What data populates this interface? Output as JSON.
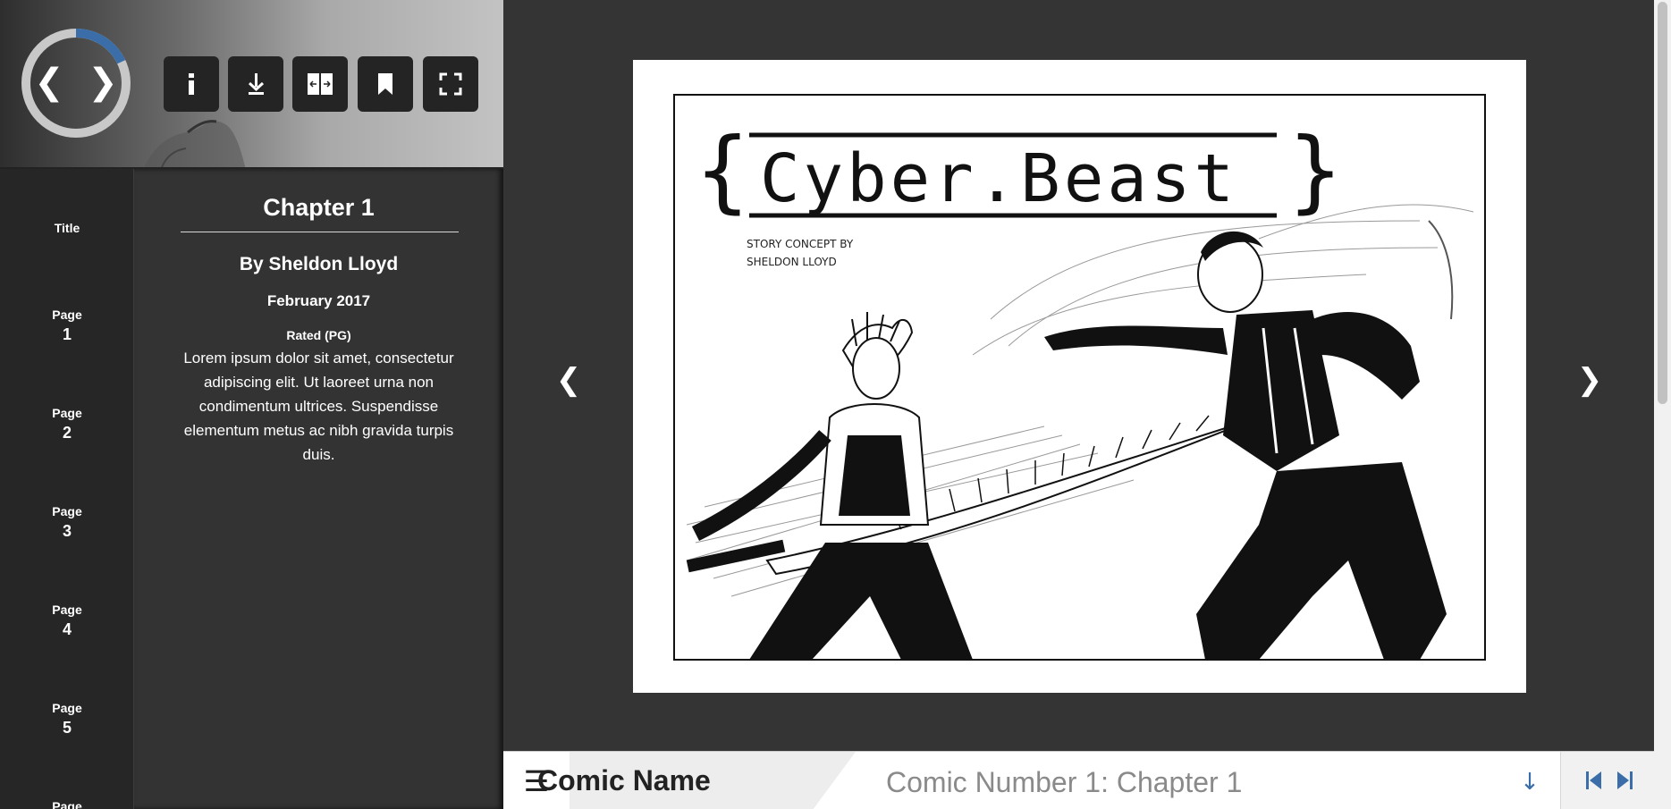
{
  "toolbar": {
    "prev_symbol": "❮",
    "next_symbol": "❯",
    "progress": 0.18,
    "progress_color": "#3b6ea8",
    "buttons": [
      {
        "name": "info-button",
        "icon": "info-icon"
      },
      {
        "name": "download-button",
        "icon": "download-icon"
      },
      {
        "name": "page-spread-button",
        "icon": "spread-icon"
      },
      {
        "name": "bookmark-button",
        "icon": "bookmark-icon"
      },
      {
        "name": "fullscreen-button",
        "icon": "fullscreen-icon"
      }
    ]
  },
  "page_list": [
    {
      "label": "Title",
      "number": ""
    },
    {
      "label": "Page",
      "number": "1"
    },
    {
      "label": "Page",
      "number": "2"
    },
    {
      "label": "Page",
      "number": "3"
    },
    {
      "label": "Page",
      "number": "4"
    },
    {
      "label": "Page",
      "number": "5"
    },
    {
      "label": "Page",
      "number": ""
    }
  ],
  "info": {
    "chapter_title": "Chapter 1",
    "author": "By Sheldon Lloyd",
    "date": "February 2017",
    "rating": "Rated (PG)",
    "description": "Lorem ipsum dolor sit amet, consectetur adipiscing elit. Ut laoreet urna non condimentum ultrices. Suspendisse elementum metus ac nibh gravida turpis duis."
  },
  "reader": {
    "prev_symbol": "❮",
    "next_symbol": "❯",
    "comic_title": "Cyber.Beast",
    "brace_open": "{",
    "brace_close": "}",
    "credit_line1": "STORY CONCEPT BY",
    "credit_line2": "SHELDON LLOYD"
  },
  "bottom_bar": {
    "menu_symbol": "☰",
    "comic_name": "Comic Name",
    "comic_subtitle": "Comic Number 1: Chapter 1",
    "dropdown_symbol": "↓",
    "accent_color": "#3b6ea8"
  }
}
